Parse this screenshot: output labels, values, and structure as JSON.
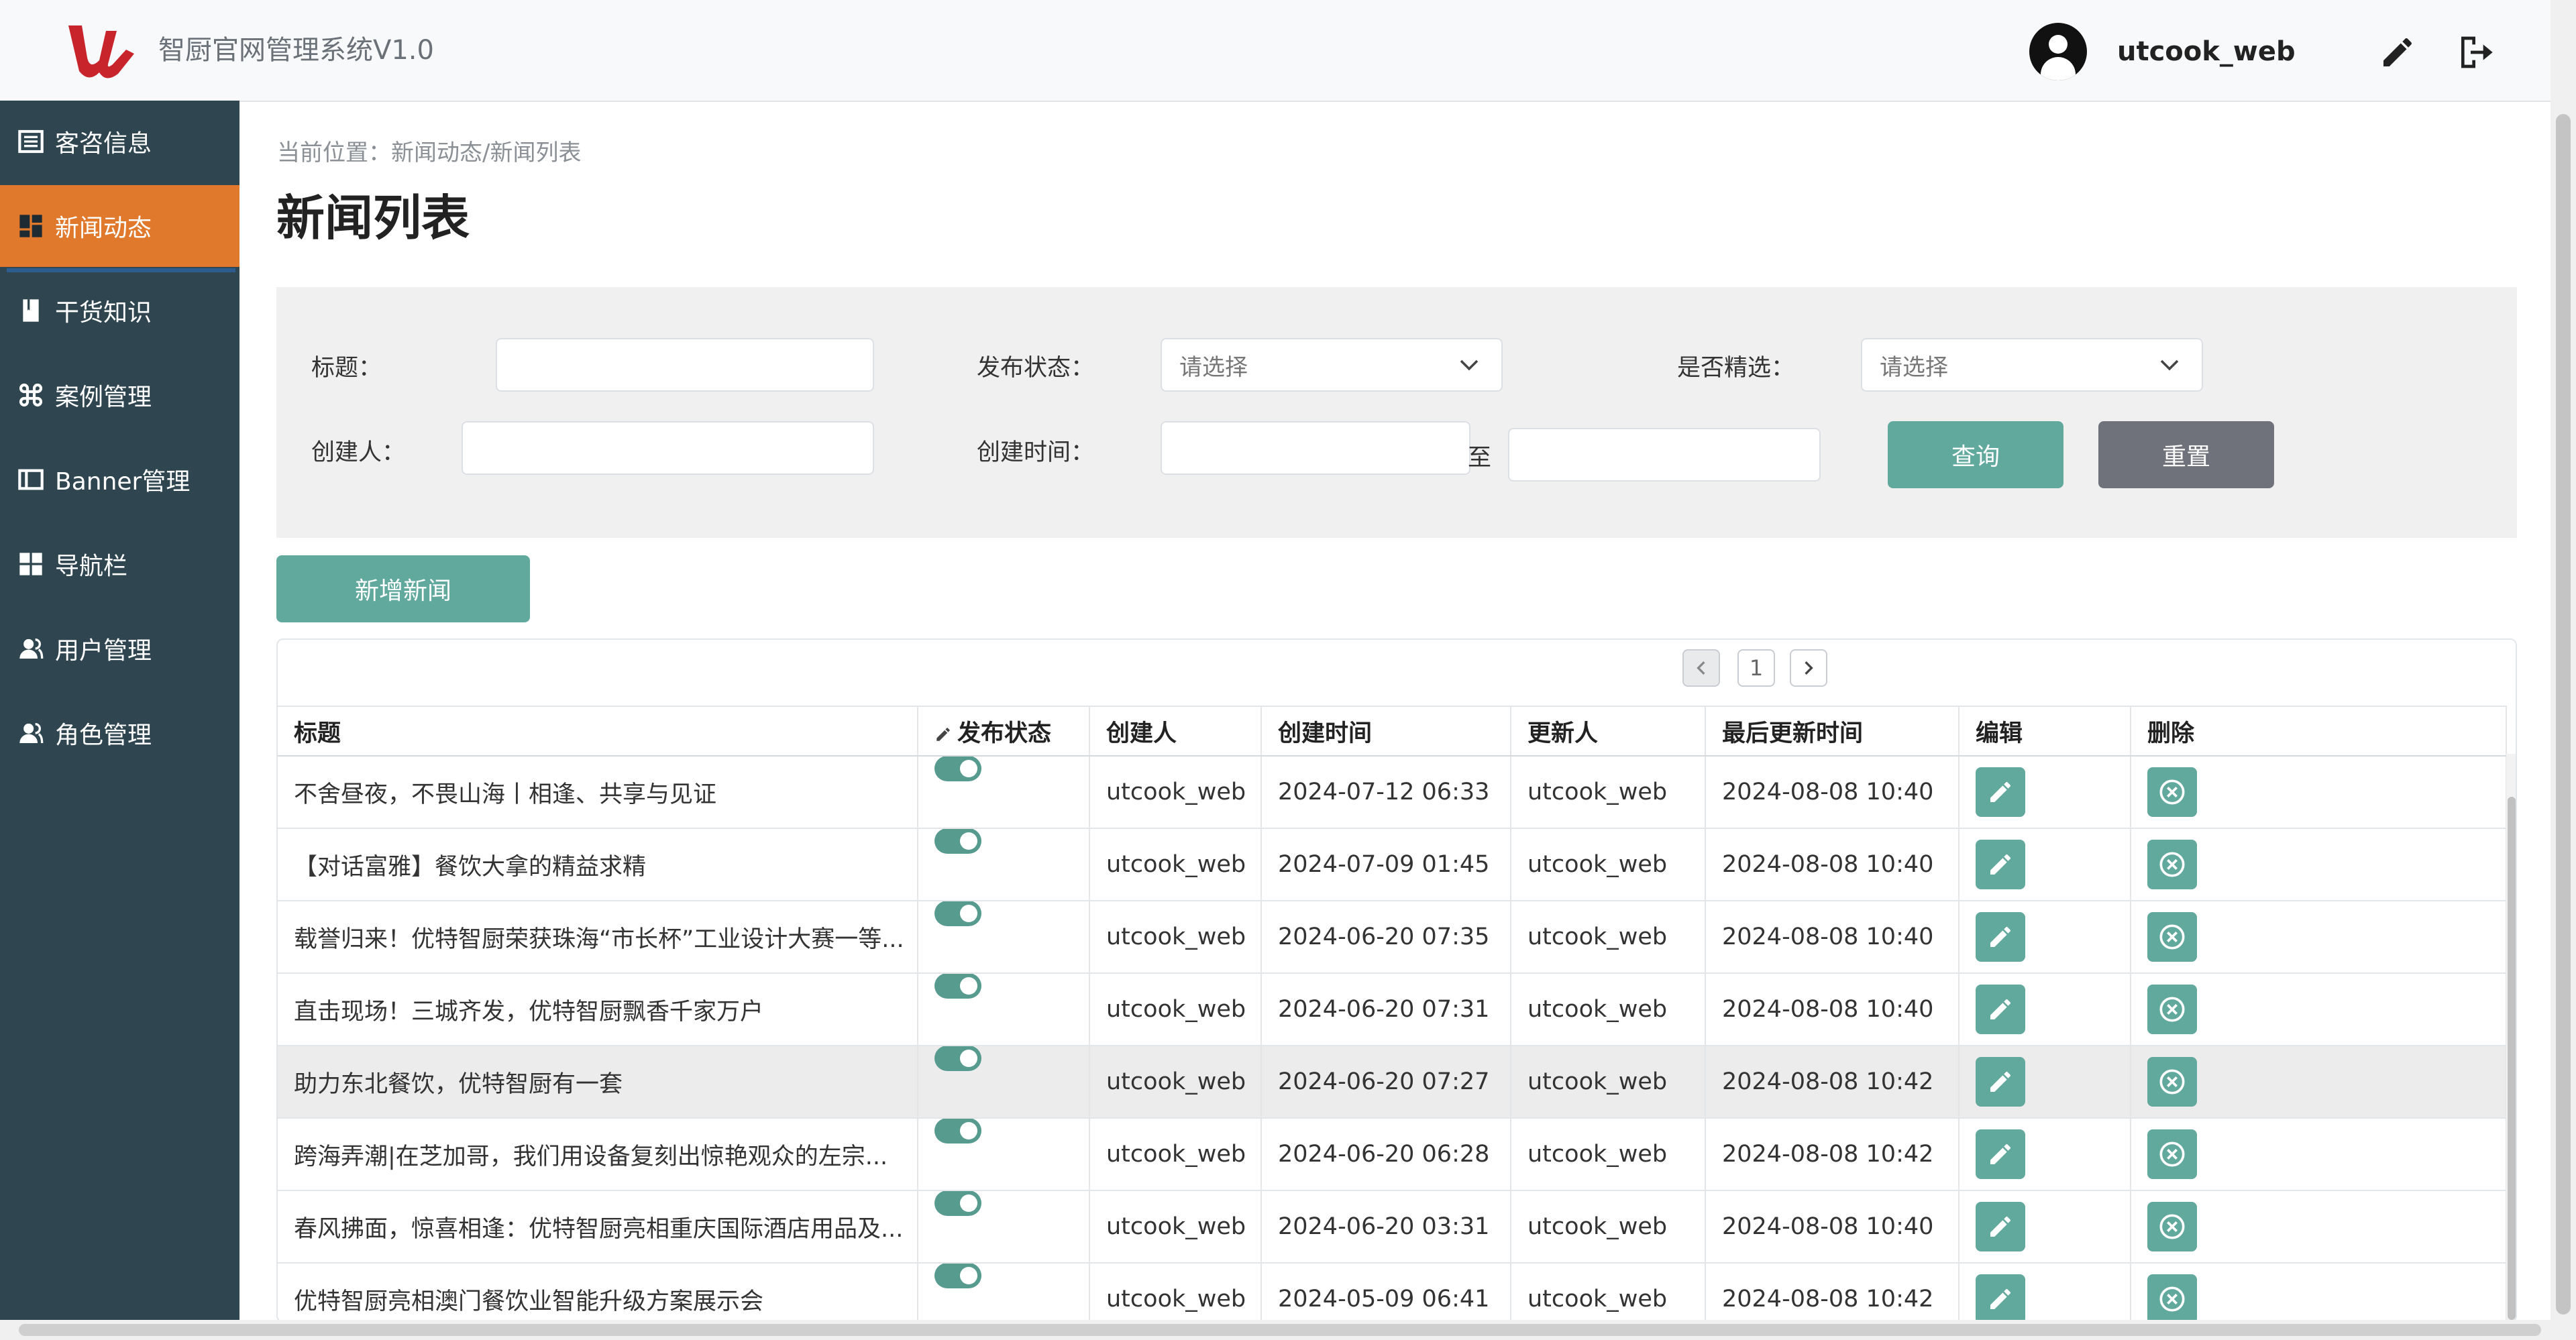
{
  "app": {
    "title": "智厨官网管理系统V1.0",
    "username": "utcook_web"
  },
  "sidebar": {
    "items": [
      {
        "label": "客咨信息",
        "icon": "list-icon"
      },
      {
        "label": "新闻动态",
        "icon": "dashboard-icon",
        "active": true
      },
      {
        "label": "干货知识",
        "icon": "book-icon"
      },
      {
        "label": "案例管理",
        "icon": "command-icon"
      },
      {
        "label": "Banner管理",
        "icon": "columns-icon"
      },
      {
        "label": "导航栏",
        "icon": "grid-icon"
      },
      {
        "label": "用户管理",
        "icon": "users-icon"
      },
      {
        "label": "角色管理",
        "icon": "users-icon"
      }
    ]
  },
  "breadcrumb": "当前位置：新闻动态/新闻列表",
  "page_title": "新闻列表",
  "filters": {
    "title_label": "标题：",
    "title_value": "",
    "status_label": "发布状态：",
    "status_placeholder": "请选择",
    "featured_label": "是否精选：",
    "featured_placeholder": "请选择",
    "creator_label": "创建人：",
    "creator_value": "",
    "created_time_label": "创建时间：",
    "range_separator": "至",
    "query_button": "查询",
    "reset_button": "重置"
  },
  "add_button": "新增新闻",
  "pagination": {
    "current_page": "1"
  },
  "table": {
    "columns": [
      "标题",
      "发布状态",
      "创建人",
      "创建时间",
      "更新人",
      "最后更新时间",
      "编辑",
      "删除"
    ],
    "rows": [
      {
        "title": "不舍昼夜，不畏山海丨相逢、共享与见证",
        "published": true,
        "creator": "utcook_web",
        "created": "2024-07-12 06:33",
        "updater": "utcook_web",
        "updated": "2024-08-08 10:40"
      },
      {
        "title": "【对话富雅】餐饮大拿的精益求精",
        "published": true,
        "creator": "utcook_web",
        "created": "2024-07-09 01:45",
        "updater": "utcook_web",
        "updated": "2024-08-08 10:40"
      },
      {
        "title": "载誉归来！优特智厨荣获珠海“市长杯”工业设计大赛一等...",
        "published": true,
        "creator": "utcook_web",
        "created": "2024-06-20 07:35",
        "updater": "utcook_web",
        "updated": "2024-08-08 10:40"
      },
      {
        "title": "直击现场！三城齐发，优特智厨飘香千家万户",
        "published": true,
        "creator": "utcook_web",
        "created": "2024-06-20 07:31",
        "updater": "utcook_web",
        "updated": "2024-08-08 10:40"
      },
      {
        "title": "助力东北餐饮，优特智厨有一套",
        "published": true,
        "creator": "utcook_web",
        "created": "2024-06-20 07:27",
        "updater": "utcook_web",
        "updated": "2024-08-08 10:42",
        "highlight": true
      },
      {
        "title": "跨海弄潮|在芝加哥，我们用设备复刻出惊艳观众的左宗...",
        "published": true,
        "creator": "utcook_web",
        "created": "2024-06-20 06:28",
        "updater": "utcook_web",
        "updated": "2024-08-08 10:42"
      },
      {
        "title": "春风拂面，惊喜相逢：优特智厨亮相重庆国际酒店用品及...",
        "published": true,
        "creator": "utcook_web",
        "created": "2024-06-20 03:31",
        "updater": "utcook_web",
        "updated": "2024-08-08 10:40"
      },
      {
        "title": "优特智厨亮相澳门餐饮业智能升级方案展示会",
        "published": true,
        "creator": "utcook_web",
        "created": "2024-05-09 06:41",
        "updater": "utcook_web",
        "updated": "2024-08-08 10:42"
      }
    ]
  },
  "colors": {
    "sidebar_bg": "#2f4650",
    "active_item": "#e0792c",
    "teal": "#62a99d",
    "toggle_on": "#579b8f",
    "logo_red": "#c8242b"
  }
}
